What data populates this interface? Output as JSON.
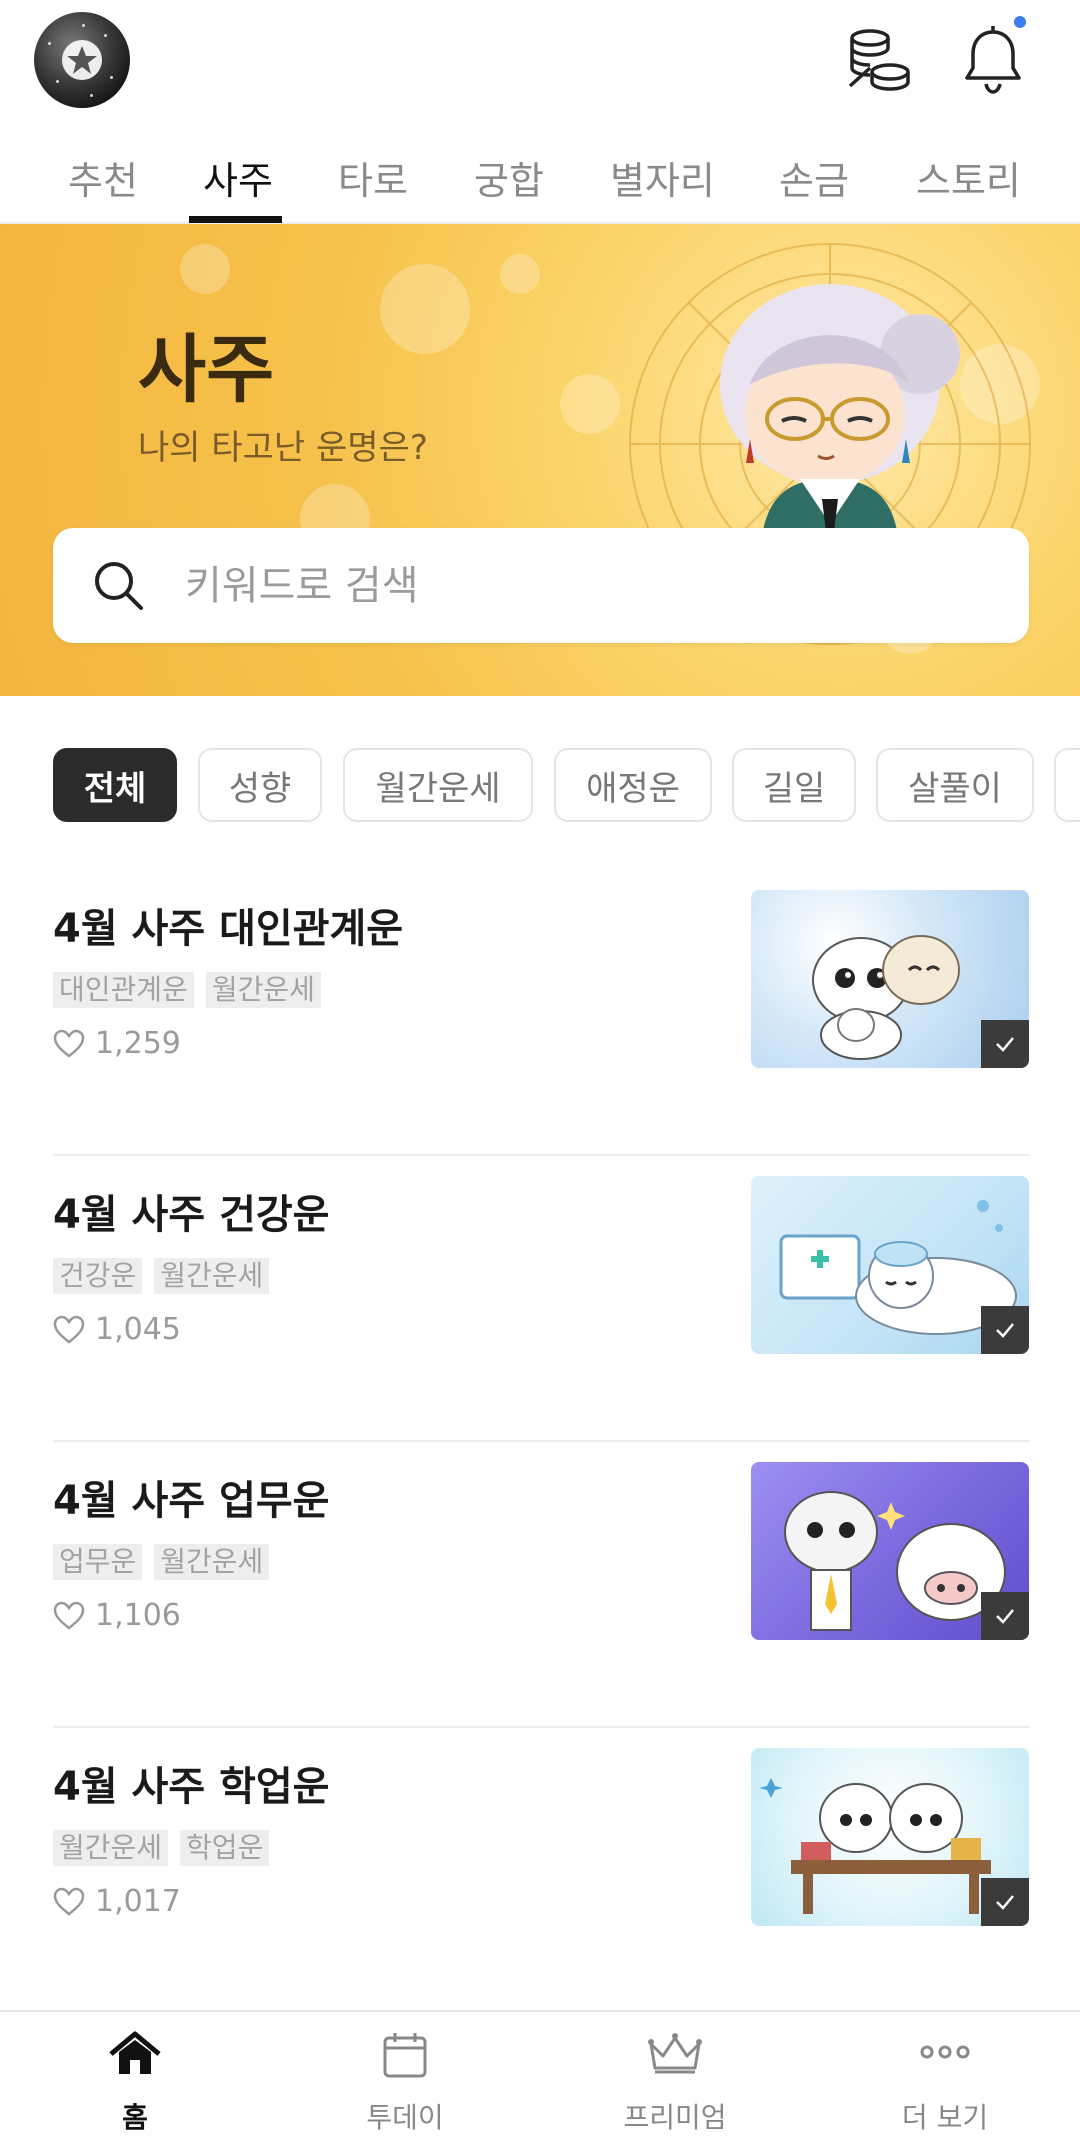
{
  "header": {
    "avatar_icon": "star-avatar-icon",
    "coins_icon": "coins-icon",
    "bell_icon": "bell-icon",
    "notification_dot_color": "#3d7bf0"
  },
  "tabs": [
    {
      "label": "추천"
    },
    {
      "label": "사주",
      "active": true
    },
    {
      "label": "타로"
    },
    {
      "label": "궁합"
    },
    {
      "label": "별자리"
    },
    {
      "label": "손금"
    },
    {
      "label": "스토리"
    }
  ],
  "hero": {
    "title": "사주",
    "subtitle": "나의 타고난 운명은?",
    "accent_color": "#f6c14a"
  },
  "search": {
    "placeholder": "키워드로 검색"
  },
  "chips": [
    {
      "label": "전체",
      "active": true
    },
    {
      "label": "성향"
    },
    {
      "label": "월간운세"
    },
    {
      "label": "애정운"
    },
    {
      "label": "길일"
    },
    {
      "label": "살풀이"
    }
  ],
  "items": [
    {
      "title": "4월 사주 대인관계운",
      "tags": [
        "대인관계운",
        "월간운세"
      ],
      "likes": "1,259"
    },
    {
      "title": "4월 사주 건강운",
      "tags": [
        "건강운",
        "월간운세"
      ],
      "likes": "1,045"
    },
    {
      "title": "4월 사주 업무운",
      "tags": [
        "업무운",
        "월간운세"
      ],
      "likes": "1,106"
    },
    {
      "title": "4월 사주 학업운",
      "tags": [
        "월간운세",
        "학업운"
      ],
      "likes": "1,017"
    }
  ],
  "bottom_nav": [
    {
      "label": "홈",
      "icon": "home-icon",
      "active": true
    },
    {
      "label": "투데이",
      "icon": "calendar-icon"
    },
    {
      "label": "프리미엄",
      "icon": "crown-icon"
    },
    {
      "label": "더 보기",
      "icon": "more-icon"
    }
  ]
}
